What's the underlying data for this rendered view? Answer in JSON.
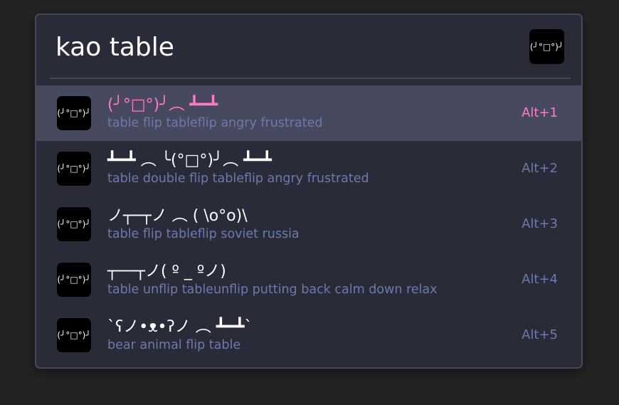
{
  "search": {
    "value": "kao table",
    "icon_text": "(╯°□°)╯",
    "icon": "kaomoji-icon"
  },
  "results": [
    {
      "title": "(╯°□°)╯︵ ┻━┻",
      "subtitle": "table flip tableflip angry frustrated",
      "shortcut": "Alt+1",
      "icon_text": "(╯°□°)╯",
      "selected": true
    },
    {
      "title": "┻━┻ ︵ ╰(°□°)╯︵ ┻━┻",
      "subtitle": "table double flip tableflip angry frustrated",
      "shortcut": "Alt+2",
      "icon_text": "(╯°□°)╯",
      "selected": false
    },
    {
      "title": "ノ┬─┬ノ ︵ ( \\o°o)\\",
      "subtitle": "table flip tableflip soviet russia",
      "shortcut": "Alt+3",
      "icon_text": "(╯°□°)╯",
      "selected": false
    },
    {
      "title": "┬──┬ノ( º _ ºノ)",
      "subtitle": "table unflip tableunflip putting back calm down relax",
      "shortcut": "Alt+4",
      "icon_text": "(╯°□°)╯",
      "selected": false
    },
    {
      "title": "`ʕノ•ᴥ•ʔノ ︵ ┻━┻`",
      "subtitle": "bear animal flip table",
      "shortcut": "Alt+5",
      "icon_text": "(╯°□°)╯",
      "selected": false
    }
  ],
  "colors": {
    "background": "#232323",
    "panel": "#2a2b39",
    "border": "#464859",
    "selected_row": "#474a5e",
    "accent": "#ff79c6",
    "subtitle": "#6d7aab",
    "text": "#ffffff"
  }
}
